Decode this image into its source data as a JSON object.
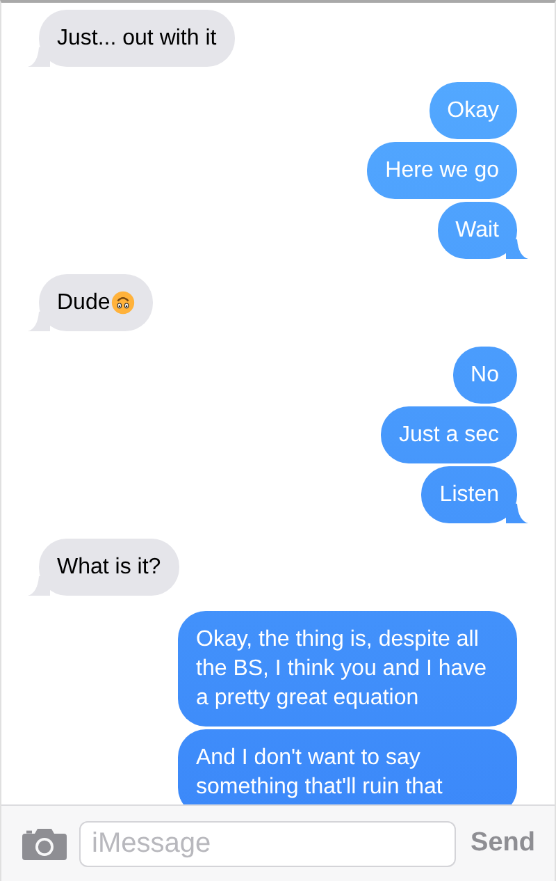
{
  "messages": [
    {
      "kind": "received",
      "text": "Just... out with it",
      "tail": true,
      "emoji": false
    },
    {
      "kind": "sent",
      "text": "Okay",
      "tail": false,
      "emoji": false
    },
    {
      "kind": "sent",
      "text": "Here we go",
      "tail": false,
      "emoji": false
    },
    {
      "kind": "sent",
      "text": "Wait",
      "tail": true,
      "emoji": false
    },
    {
      "kind": "received",
      "text": "Dude",
      "tail": true,
      "emoji": true
    },
    {
      "kind": "sent",
      "text": "No",
      "tail": false,
      "emoji": false
    },
    {
      "kind": "sent",
      "text": "Just a sec",
      "tail": false,
      "emoji": false
    },
    {
      "kind": "sent",
      "text": "Listen",
      "tail": true,
      "emoji": false
    },
    {
      "kind": "received",
      "text": "What is it?",
      "tail": true,
      "emoji": false
    },
    {
      "kind": "sent",
      "text": "Okay, the thing is, despite all the BS, I think you and I have a pretty great equation",
      "tail": false,
      "emoji": false
    },
    {
      "kind": "sent",
      "text": "And I don't want to say something that'll ruin that",
      "tail": false,
      "emoji": false
    }
  ],
  "composer": {
    "placeholder": "iMessage",
    "send": "Send",
    "send_disabled": true
  }
}
